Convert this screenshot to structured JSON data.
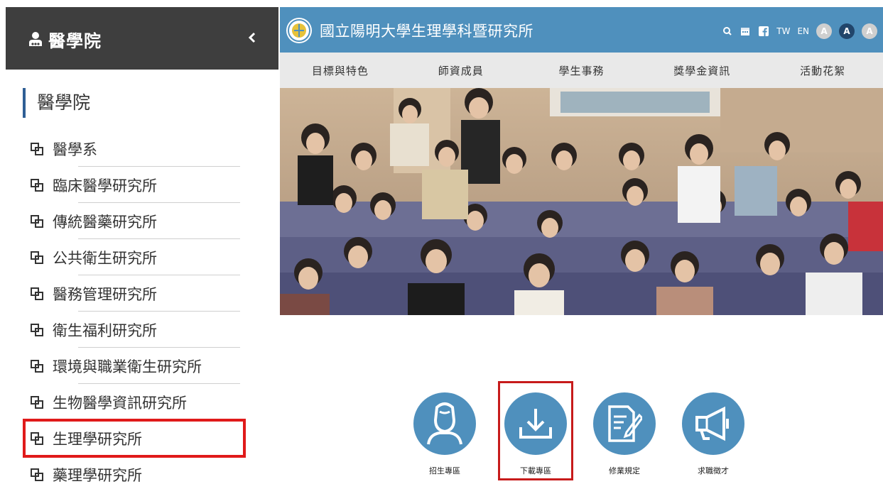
{
  "sidebar": {
    "title": "醫學院",
    "section_heading": "醫學院",
    "items": [
      {
        "label": "醫學系"
      },
      {
        "label": "臨床醫學研究所"
      },
      {
        "label": "傳統醫藥研究所"
      },
      {
        "label": "公共衛生研究所"
      },
      {
        "label": "醫務管理研究所"
      },
      {
        "label": "衛生福利研究所"
      },
      {
        "label": "環境與職業衛生研究所"
      },
      {
        "label": "生物醫學資訊研究所"
      },
      {
        "label": "生理學研究所",
        "highlighted": true
      },
      {
        "label": "藥理學研究所"
      }
    ]
  },
  "header": {
    "site_title": "國立陽明大學生理學科暨研究所",
    "lang_tw": "TW",
    "lang_en": "EN",
    "font_small": "A",
    "font_medium": "A",
    "font_large": "A"
  },
  "nav": [
    {
      "label": "目標與特色"
    },
    {
      "label": "師資成員"
    },
    {
      "label": "學生事務"
    },
    {
      "label": "獎學金資訊"
    },
    {
      "label": "活動花絮"
    }
  ],
  "quick_links": [
    {
      "label": "招生專區",
      "icon": "person-icon"
    },
    {
      "label": "下載專區",
      "icon": "download-icon",
      "highlighted": true
    },
    {
      "label": "修業規定",
      "icon": "document-edit-icon"
    },
    {
      "label": "求職徵才",
      "icon": "megaphone-icon"
    }
  ],
  "colors": {
    "brand_blue": "#4f90bd",
    "sidebar_dark": "#3e3e3e",
    "highlight_red": "#e01a1a",
    "nav_bg": "#e9e9e9"
  }
}
